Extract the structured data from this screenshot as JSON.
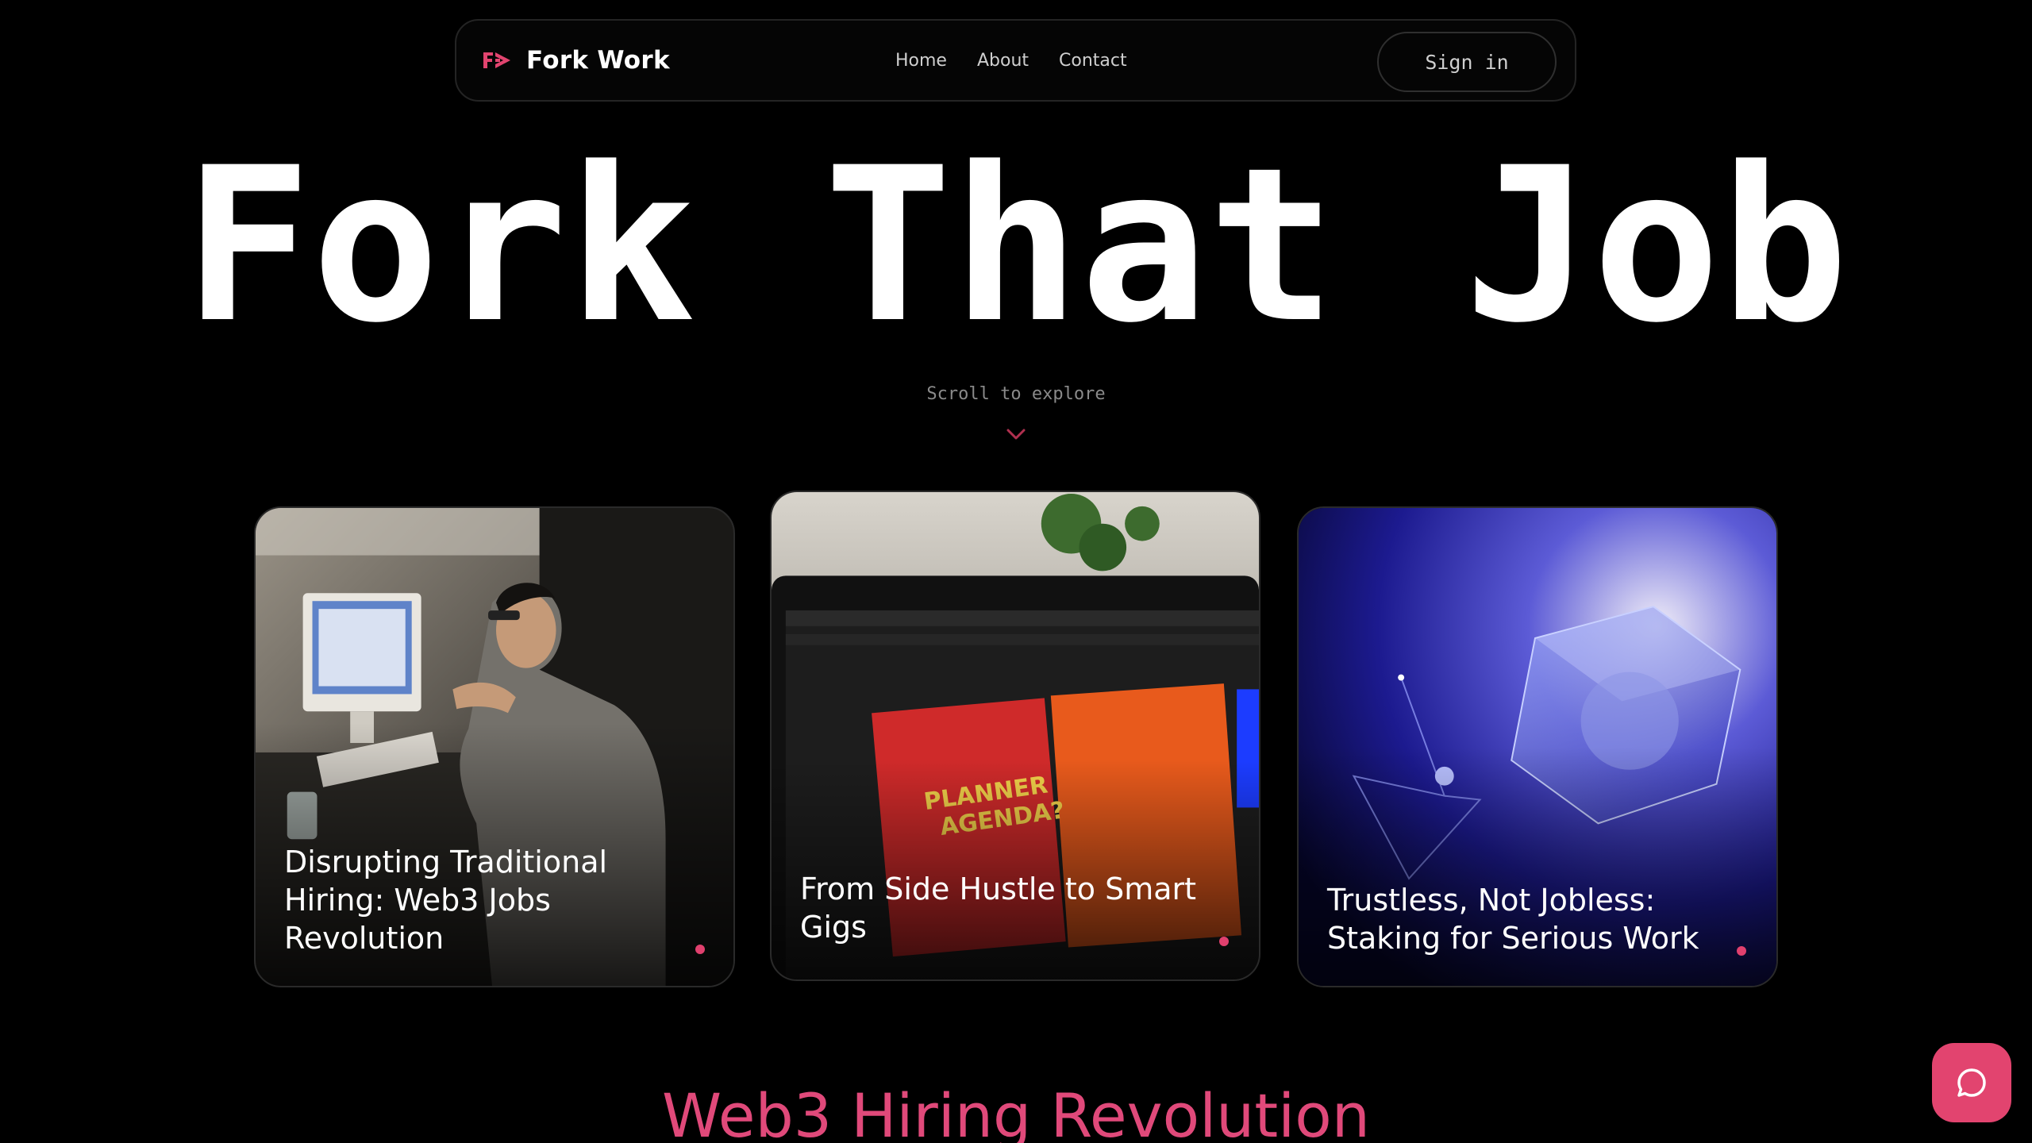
{
  "nav": {
    "brand": "Fork Work",
    "links": [
      "Home",
      "About",
      "Contact"
    ],
    "sign_in": "Sign in"
  },
  "hero": {
    "title": "Fork That Job",
    "scroll_hint": "Scroll to explore"
  },
  "cards": [
    {
      "title": "Disrupting Traditional Hiring: Web3 Jobs Revolution",
      "image": "man-working-at-computer"
    },
    {
      "title": "From Side Hustle to Smart Gigs",
      "image": "photoshop-design-on-laptop"
    },
    {
      "title": "Trustless, Not Jobless: Staking for Serious Work",
      "image": "abstract-blue-glass-cube"
    }
  ],
  "section": {
    "heading": "Web3 Hiring Revolution"
  },
  "colors": {
    "accent": "#e2446f",
    "background": "#000000"
  },
  "icons": {
    "brand": "fork-work-logo-icon",
    "scroll": "chevron-down-icon",
    "chat": "chat-bubble-icon"
  }
}
